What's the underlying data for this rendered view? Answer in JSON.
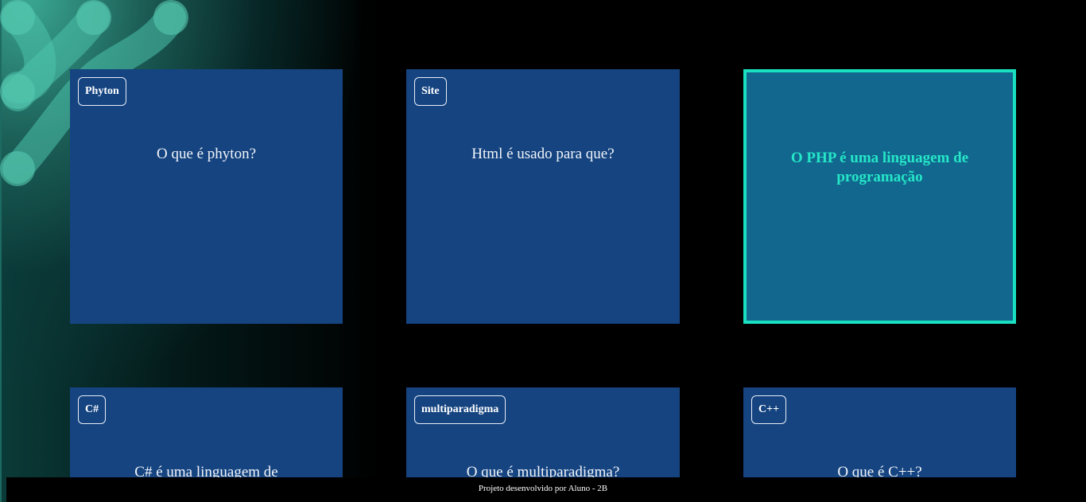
{
  "cards": [
    {
      "tag": "Phyton",
      "question": "O que é phyton?"
    },
    {
      "tag": "Site",
      "question": "Html é usado para que?"
    },
    {
      "answer": "O PHP é uma linguagem de programação"
    },
    {
      "tag": "C#",
      "question": "C# é uma linguagem de"
    },
    {
      "tag": "multiparadigma",
      "question": "O que é multiparadigma?"
    },
    {
      "tag": "C++",
      "question": "O que é C++?"
    }
  ],
  "footer": {
    "text": "Projeto desenvolvido por Aluno - 2B"
  },
  "colors": {
    "card_bg": "#154480",
    "card_flipped_bg": "#11678d",
    "accent": "#18e0c0",
    "answer_text": "#25e6c8"
  }
}
